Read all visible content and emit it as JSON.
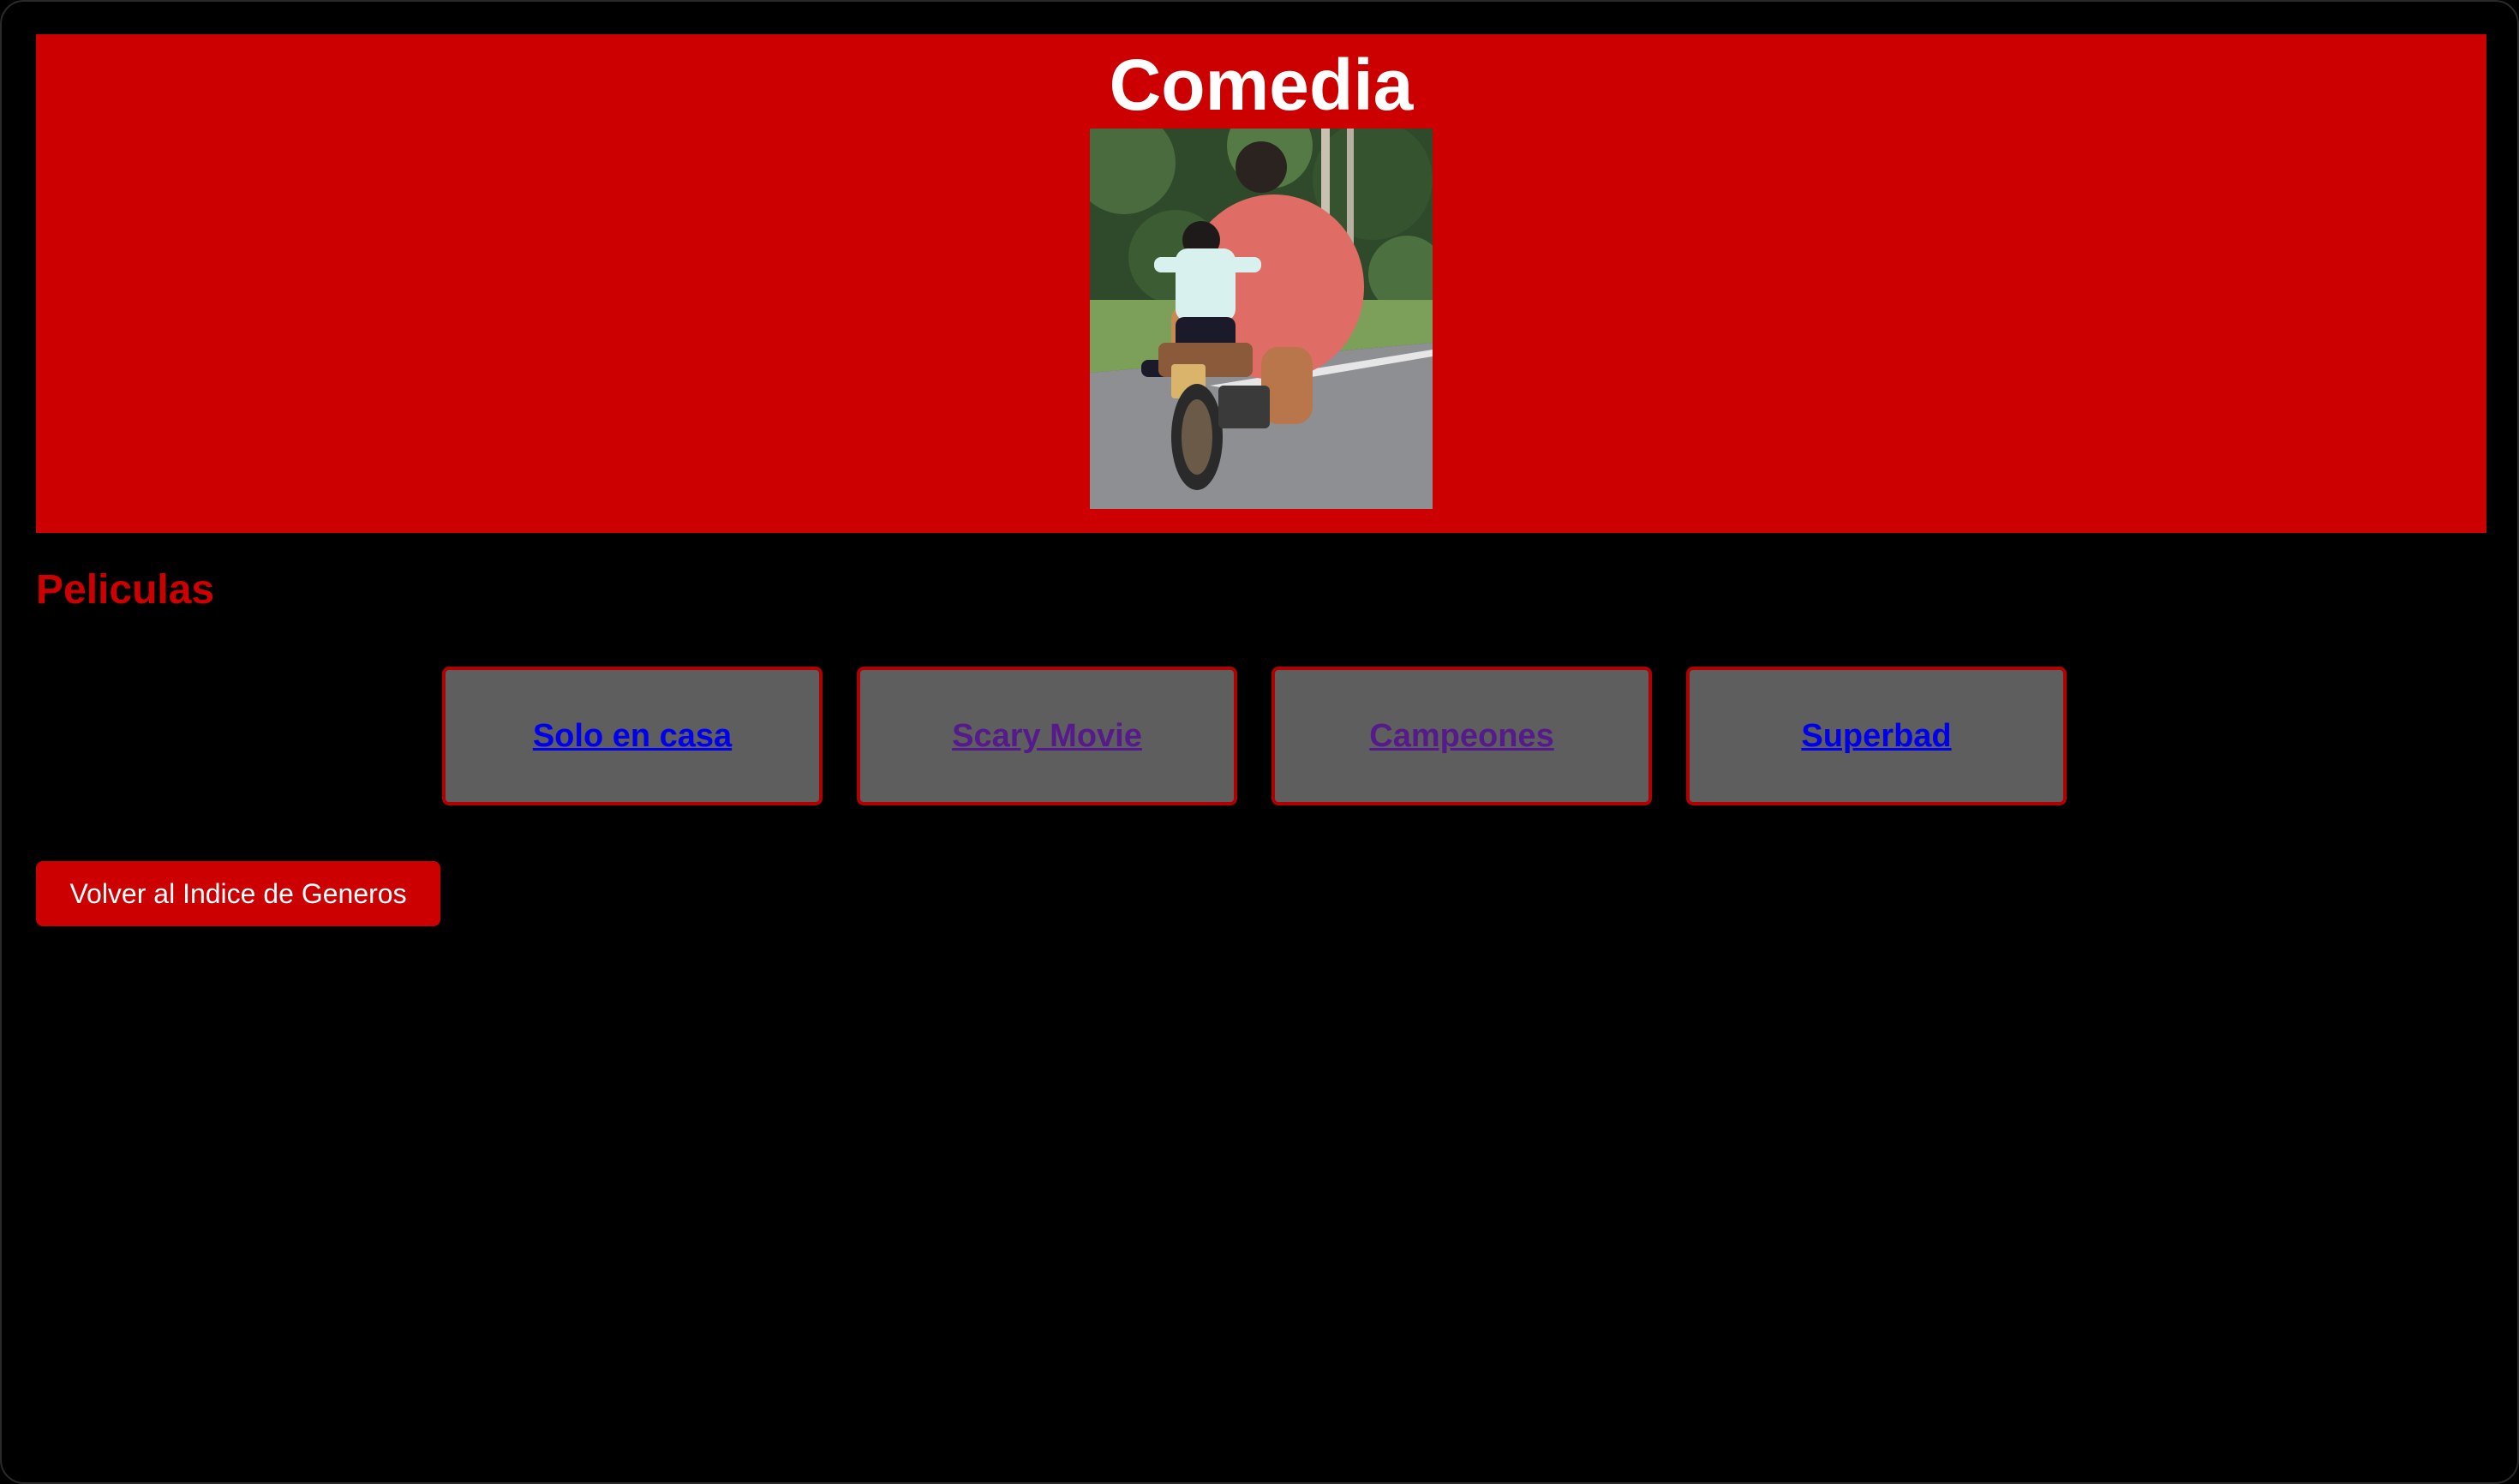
{
  "header": {
    "title": "Comedia",
    "photo_icon": "photo-of-person-and-child-on-motorcycle"
  },
  "section": {
    "title": "Peliculas"
  },
  "movies": [
    {
      "label": "Solo en casa",
      "state": "unvisited"
    },
    {
      "label": "Scary Movie",
      "state": "visited"
    },
    {
      "label": "Campeones",
      "state": "visited"
    },
    {
      "label": "Superbad",
      "state": "unvisited"
    }
  ],
  "back_button": {
    "label": "Volver al Indice de Generos"
  },
  "colors": {
    "accent": "#cc0000",
    "background": "#000000",
    "card": "#5e5e5e",
    "link": "#0000ee",
    "visited_link": "#551a8b"
  }
}
